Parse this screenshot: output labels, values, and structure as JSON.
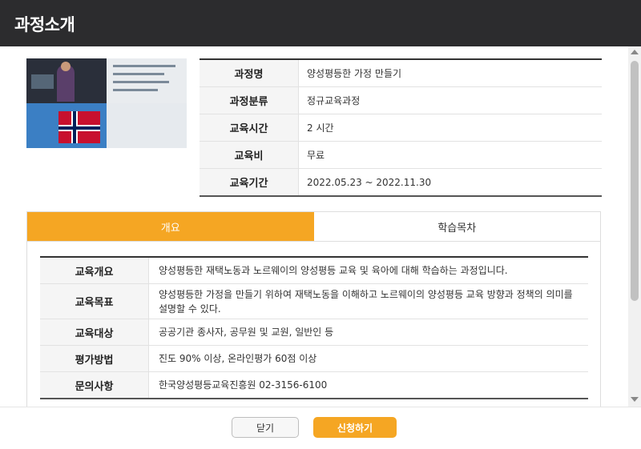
{
  "header": {
    "title": "과정소개"
  },
  "thumbnail": {
    "icon": "course-thumbnail-image"
  },
  "info": {
    "rows": [
      {
        "label": "과정명",
        "value": "양성평등한 가정 만들기"
      },
      {
        "label": "과정분류",
        "value": "정규교육과정"
      },
      {
        "label": "교육시간",
        "value": "2 시간"
      },
      {
        "label": "교육비",
        "value": "무료"
      },
      {
        "label": "교육기간",
        "value": "2022.05.23 ~ 2022.11.30"
      }
    ]
  },
  "tabs": [
    {
      "label": "개요",
      "active": true
    },
    {
      "label": "학습목차",
      "active": false
    }
  ],
  "detail": {
    "rows": [
      {
        "label": "교육개요",
        "value": "양성평등한 재택노동과 노르웨이의 양성평등 교육 및 육아에 대해 학습하는 과정입니다."
      },
      {
        "label": "교육목표",
        "value": "양성평등한 가정을 만들기 위하여 재택노동을 이해하고 노르웨이의 양성평등 교육 방향과 정책의 의미를 설명할 수 있다."
      },
      {
        "label": "교육대상",
        "value": "공공기관 종사자, 공무원 및 교원, 일반인 등"
      },
      {
        "label": "평가방법",
        "value": "진도 90% 이상, 온라인평가 60점 이상"
      },
      {
        "label": "문의사항",
        "value": "한국양성평등교육진흥원 02-3156-6100"
      }
    ]
  },
  "footer": {
    "close_label": "닫기",
    "apply_label": "신청하기"
  },
  "colors": {
    "accent": "#f5a623",
    "header_bg": "#2c2c2e"
  }
}
